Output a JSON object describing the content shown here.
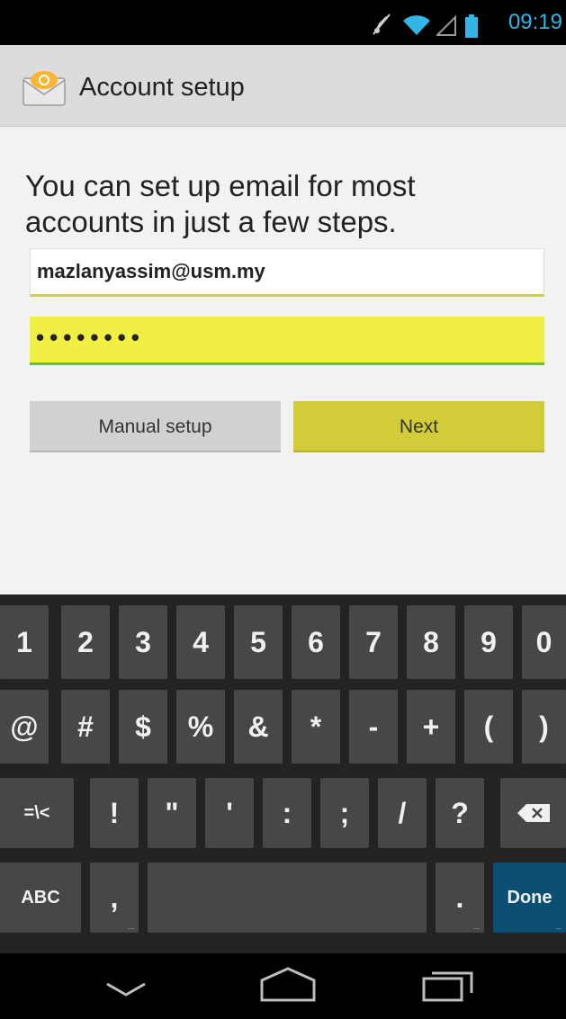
{
  "status_bar": {
    "time": "09:19",
    "icons": [
      "mute-icon",
      "wifi-icon",
      "signal-icon",
      "battery-icon"
    ],
    "accent_color": "#33b5e5"
  },
  "action_bar": {
    "title": "Account setup",
    "icon": "email-app-icon"
  },
  "content": {
    "intro": "You can set up email for most accounts in just a few steps.",
    "email_value": "mazlanyassim@usm.my",
    "password_value": "••••••••",
    "manual_setup_label": "Manual setup",
    "next_label": "Next"
  },
  "keyboard": {
    "row1": [
      "1",
      "2",
      "3",
      "4",
      "5",
      "6",
      "7",
      "8",
      "9",
      "0"
    ],
    "row2": [
      "@",
      "#",
      "$",
      "%",
      "&",
      "*",
      "-",
      "+",
      "(",
      ")"
    ],
    "row3": [
      "=\\<",
      "!",
      "\"",
      "'",
      ":",
      ";",
      "/",
      "?"
    ],
    "row3_backspace": "backspace-icon",
    "row4_abc": "ABC",
    "row4_comma": ",",
    "row4_period": ".",
    "row4_done": "Done"
  },
  "nav_bar": {
    "icons": [
      "back-icon",
      "home-icon",
      "recent-apps-icon"
    ]
  },
  "colors": {
    "password_highlight": "#f1ee44",
    "next_button": "#d3cc39",
    "done_key": "#0b4f74"
  }
}
